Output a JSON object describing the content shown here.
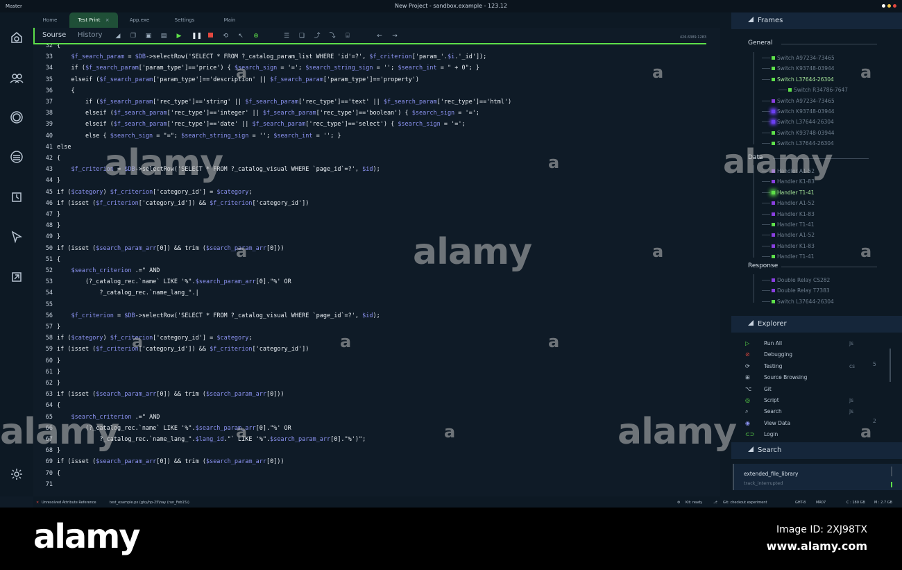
{
  "titlebar": {
    "app": "Master",
    "title": "New Project - sandbox.example - 123.12",
    "dot_colors": [
      "#ffffff",
      "#f2c84b",
      "#e2483f"
    ]
  },
  "nav": {
    "tabs": [
      {
        "label": "Home"
      },
      {
        "label": "Test Print"
      },
      {
        "label": "App.exe"
      },
      {
        "label": "Settings"
      },
      {
        "label": "Main"
      }
    ],
    "close_glyph": "×"
  },
  "toolbar": {
    "source_tab": "Sourse",
    "history_tab": "History",
    "coords": "426.6389.1283"
  },
  "code_lines": [
    {
      "n": "32",
      "t": "{"
    },
    {
      "n": "33",
      "t": "    $f_search_param = $DB->selectRow('SELECT * FROM ?_catalog_param_list WHERE 'id'=?', $f_criterion['param_'.$i.'_id']);"
    },
    {
      "n": "34",
      "t": "    if ($f_search_param['param_type']=='price') { $search_sign = '='; $search_string_sign = ''; $search_int = \" + 0\"; }"
    },
    {
      "n": "35",
      "t": "    elseif ($f_search_param['param_type']=='description' || $f_search_param['param_type']=='property')"
    },
    {
      "n": "36",
      "t": "    {"
    },
    {
      "n": "37",
      "t": "        if ($f_search_param['rec_type']=='string' || $f_search_param['rec_type']=='text' || $f_search_param['rec_type']=='html')"
    },
    {
      "n": "38",
      "t": "        elseif ($f_search_param['rec_type']=='integer' || $f_search_param['rec_type']=='boolean') { $search_sign = '=';"
    },
    {
      "n": "39",
      "t": "        elseif ($f_search_param['rec_type']=='date' || $f_search_param['rec_type']=='select') { $search_sign = '=';"
    },
    {
      "n": "40",
      "t": "        else { $search_sign = \"=\"; $search_string_sign = ''; $search_int = ''; }"
    },
    {
      "n": "41",
      "t": "else"
    },
    {
      "n": "42",
      "t": "{"
    },
    {
      "n": "43",
      "t": "    $f_criterion = $DB->selectRow('SELECT * FROM ?_catalog_visual WHERE `page_id`=?', $id);"
    },
    {
      "n": "44",
      "t": "}"
    },
    {
      "n": "45",
      "t": "if ($category) $f_criterion['category_id'] = $category;"
    },
    {
      "n": "46",
      "t": "if (isset ($f_criterion['category_id']) && $f_criterion['category_id'])"
    },
    {
      "n": "47",
      "t": "}"
    },
    {
      "n": "48",
      "t": "}"
    },
    {
      "n": "49",
      "t": "}"
    },
    {
      "n": "50",
      "t": "if (isset ($search_param_arr[0]) && trim ($search_param_arr[0]))"
    },
    {
      "n": "51",
      "t": "{"
    },
    {
      "n": "52",
      "t": "    $search_criterion .=\" AND"
    },
    {
      "n": "53",
      "t": "        (?_catalog_rec.`name` LIKE '%\".$search_param_arr[0].\"%' OR"
    },
    {
      "n": "54",
      "t": "            ?_catalog_rec.`name_lang_\".|"
    },
    {
      "n": "55",
      "t": ""
    },
    {
      "n": "56",
      "t": "    $f_criterion = $DB->selectRow('SELECT * FROM ?_catalog_visual WHERE `page_id`=?', $id);"
    },
    {
      "n": "57",
      "t": "}"
    },
    {
      "n": "58",
      "t": "if ($category) $f_criterion['category_id'] = $category;"
    },
    {
      "n": "59",
      "t": "if (isset ($f_criterion['category_id']) && $f_criterion['category_id'])"
    },
    {
      "n": "60",
      "t": "}"
    },
    {
      "n": "61",
      "t": "}"
    },
    {
      "n": "62",
      "t": "}"
    },
    {
      "n": "63",
      "t": "if (isset ($search_param_arr[0]) && trim ($search_param_arr[0]))"
    },
    {
      "n": "64",
      "t": "{"
    },
    {
      "n": "65",
      "t": "    $search_criterion .=\" AND"
    },
    {
      "n": "66",
      "t": "        (?_catalog_rec.`name` LIKE '%\".$search_param_arr[0].\"%' OR"
    },
    {
      "n": "67",
      "t": "            ?_catalog_rec.`name_lang_\".$lang_id.\"` LIKE '%\".$search_param_arr[0].\"%')\";"
    },
    {
      "n": "68",
      "t": "}"
    },
    {
      "n": "69",
      "t": "if (isset ($search_param_arr[0]) && trim ($search_param_arr[0]))"
    },
    {
      "n": "70",
      "t": "{"
    },
    {
      "n": "71",
      "t": ""
    }
  ],
  "frames": {
    "title": "Frames",
    "general_label": "General",
    "general_items": [
      {
        "label": "Switch A97234-73465",
        "color": "#5ee04a"
      },
      {
        "label": "Switch K93748-03944",
        "color": "#5ee04a"
      },
      {
        "label": "Switch L37644-26304",
        "color": "#5ee04a",
        "active": true
      },
      {
        "label": "Switch R34786-7647",
        "color": "#5ee04a",
        "sub": true
      },
      {
        "label": "Switch A97234-73465",
        "color": "#8a3fe0"
      },
      {
        "label": "Switch K93748-03944",
        "color": "#6b3ff2"
      },
      {
        "label": "Switch L37644-26304",
        "color": "#6b3ff2"
      },
      {
        "label": "Switch K93748-03944",
        "color": "#5ee04a"
      },
      {
        "label": "Switch L37644-26304",
        "color": "#5ee04a"
      }
    ],
    "data_label": "Data",
    "data_items": [
      {
        "label": "Handler A1-52",
        "color": "#8a3fe0"
      },
      {
        "label": "Handler K1-83",
        "color": "#8a3fe0"
      },
      {
        "label": "Handler T1-41",
        "color": "#5ee04a",
        "active": true
      },
      {
        "label": "Handler A1-52",
        "color": "#8a3fe0"
      },
      {
        "label": "Handler K1-83",
        "color": "#8a3fe0"
      },
      {
        "label": "Handler T1-41",
        "color": "#5ee04a"
      },
      {
        "label": "Handler A1-52",
        "color": "#8a3fe0"
      },
      {
        "label": "Handler K1-83",
        "color": "#8a3fe0"
      },
      {
        "label": "Handler T1-41",
        "color": "#5ee04a"
      }
    ],
    "response_label": "Response",
    "response_items": [
      {
        "label": "Double Relay CS282",
        "color": "#8a3fe0"
      },
      {
        "label": "Double Relay T7383",
        "color": "#8a3fe0"
      },
      {
        "label": "Switch L37644-26304",
        "color": "#5ee04a"
      }
    ]
  },
  "explorer": {
    "title": "Explorer",
    "items": [
      {
        "icon": "▷",
        "icon_name": "play-icon",
        "label": "Run All",
        "ext": "js",
        "num": ""
      },
      {
        "icon": "⊘",
        "icon_name": "bug-icon",
        "label": "Debugging",
        "ext": "",
        "num": ""
      },
      {
        "icon": "⟳",
        "icon_name": "testing-icon",
        "label": "Testing",
        "ext": "cs",
        "num": "5"
      },
      {
        "icon": "⊞",
        "icon_name": "browse-icon",
        "label": "Source Browsing",
        "ext": "",
        "num": ""
      },
      {
        "icon": "⌥",
        "icon_name": "git-icon",
        "label": "Git",
        "ext": "",
        "num": ""
      },
      {
        "icon": "◎",
        "icon_name": "script-icon",
        "label": "Script",
        "ext": "js",
        "num": ""
      },
      {
        "icon": "⌕",
        "icon_name": "search-icon",
        "label": "Search",
        "ext": "js",
        "num": ""
      },
      {
        "icon": "◉",
        "icon_name": "eye-icon",
        "label": "View Data",
        "ext": "",
        "num": "2"
      },
      {
        "icon": "⊂⊃",
        "icon_name": "link-icon",
        "label": "Login",
        "ext": "",
        "num": ""
      }
    ]
  },
  "search": {
    "title": "Search",
    "value": "extended_file_library",
    "sub": "track_interrupted"
  },
  "statusbar": {
    "error": "Unresolved Attribute Reference",
    "file": "test_example.px (ghy/hp-25\\hay (run_Feb15))",
    "kit": "Kit: ready",
    "git": "Git: checkout experiment",
    "ght": "GHT-8",
    "mr": "MR07",
    "c": "C : 180 GB",
    "m": "M : 2.7 GB"
  },
  "watermark": {
    "text": "alamy",
    "small": "a"
  },
  "footer": {
    "logo": "alamy",
    "image_id": "Image ID: 2XJ98TX",
    "site": "www.alamy.com"
  }
}
